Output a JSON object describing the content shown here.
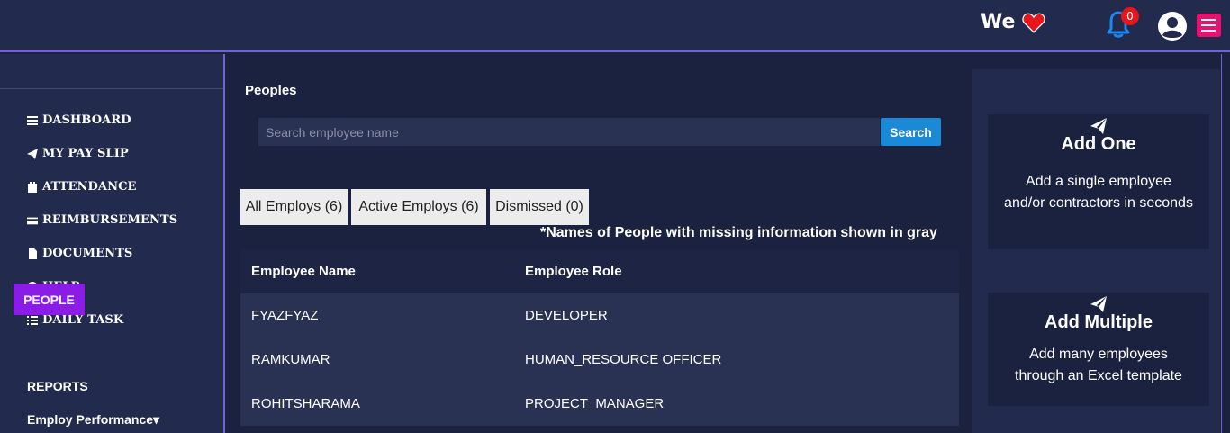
{
  "header": {
    "brand": "We",
    "notification_count": "0",
    "icons": [
      "heart-icon",
      "bell-icon",
      "user-icon",
      "hamburger-icon"
    ]
  },
  "sidebar": {
    "items": [
      {
        "label": "DASHBOARD",
        "icon": "bars-icon"
      },
      {
        "label": "MY PAY SLIP",
        "icon": "paper-plane-icon"
      },
      {
        "label": "ATTENDANCE",
        "icon": "calendar-icon"
      },
      {
        "label": "REIMBURSEMENTS",
        "icon": "credit-card-icon"
      },
      {
        "label": "DOCUMENTS",
        "icon": "file-icon"
      },
      {
        "label": "HELP",
        "icon": "question-circle-icon"
      },
      {
        "label": "DAILY TASK",
        "icon": "tasks-icon"
      }
    ],
    "active": "PEOPLE",
    "reports": "REPORTS",
    "performance": "Employ Performance▾"
  },
  "main": {
    "title": "Peoples",
    "search": {
      "placeholder": "Search employee name",
      "button": "Search"
    },
    "tabs": [
      {
        "label": "All Employs (6)"
      },
      {
        "label": "Active Employs (6)"
      },
      {
        "label": "Dismissed (0)"
      }
    ],
    "note": "*Names of People with missing information shown in gray",
    "table": {
      "headers": [
        "Employee Name",
        "Employee Role"
      ],
      "rows": [
        [
          "FYAZFYAZ",
          "DEVELOPER"
        ],
        [
          "RAMKUMAR",
          "HUMAN_RESOURCE OFFICER"
        ],
        [
          "ROHITSHARAMA",
          "PROJECT_MANAGER"
        ]
      ]
    }
  },
  "right_panel": {
    "cards": [
      {
        "title": "Add One",
        "desc": "Add a single employee and/or contractors in seconds"
      },
      {
        "title": "Add Multiple",
        "desc": "Add many employees through an Excel template"
      }
    ]
  },
  "colors": {
    "background": "#1b2240",
    "panel": "#222a4d",
    "accent_purple": "#8a1ce6",
    "search_blue": "#1a8ad6",
    "badge_red": "#e8161a",
    "menu_pink": "#e8126e"
  }
}
